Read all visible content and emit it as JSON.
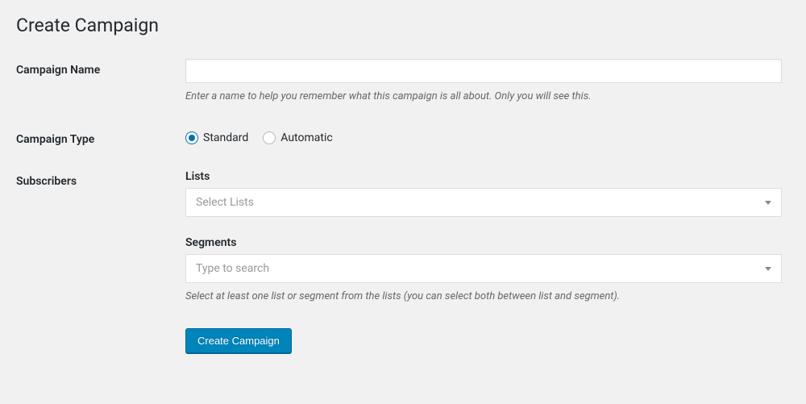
{
  "page": {
    "title": "Create Campaign"
  },
  "campaignName": {
    "label": "Campaign Name",
    "value": "",
    "help": "Enter a name to help you remember what this campaign is all about. Only you will see this."
  },
  "campaignType": {
    "label": "Campaign Type",
    "options": {
      "standard": "Standard",
      "automatic": "Automatic"
    },
    "selected": "standard"
  },
  "subscribers": {
    "label": "Subscribers",
    "lists": {
      "label": "Lists",
      "placeholder": "Select Lists"
    },
    "segments": {
      "label": "Segments",
      "placeholder": "Type to search"
    },
    "help": "Select at least one list or segment from the lists (you can select both between list and segment)."
  },
  "actions": {
    "submit": "Create Campaign"
  }
}
